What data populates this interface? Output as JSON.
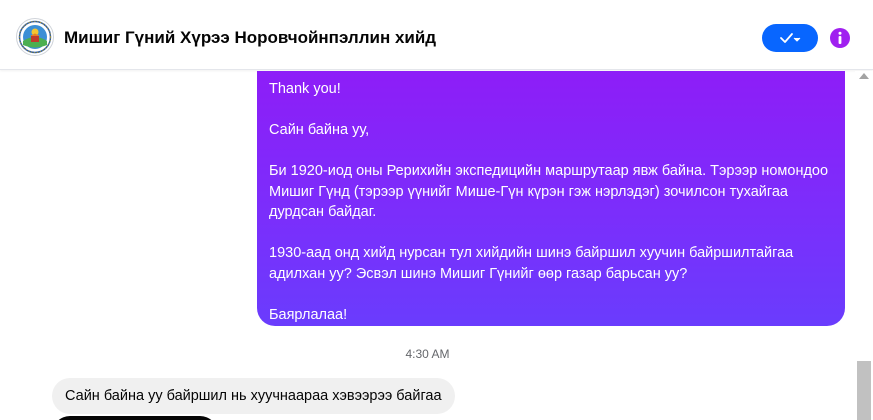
{
  "header": {
    "title": "Мишиг Гүний Хүрээ Норовчойнпэллин хийд",
    "avatar_icon": "monastery-logo-icon",
    "status_button_icon": "check-chevron-icon",
    "info_icon": "info-icon"
  },
  "messages": {
    "outgoing": {
      "lines": [
        "Thank you!",
        "",
        "Сайн байна уу,",
        "",
        "Би 1920-иод оны Рерихийн экспедицийн маршрутаар явж байна. Тэрээр номондоо Мишиг Гүнд (тэрээр үүнийг Мише-Гүн күрэн гэж нэрлэдэг) зочилсон тухайгаа дурдсан байдаг.",
        "",
        "1930-аад онд хийд нурсан тул хийдийн шинэ байршил хуучин байршилтайгаа адилхан уу? Эсвэл шинэ Мишиг Гүнийг өөр газар барьсан уу?",
        "",
        "Баярлалаа!"
      ]
    },
    "timestamp": "4:30 AM",
    "incoming": {
      "text": "Сайн байна уу байршил нь хуучнаараа хэвээрээ байгаа"
    }
  },
  "colors": {
    "accent": "#0866ff",
    "info": "#a020f0",
    "outgoing_bubble_top": "#8f1cf7",
    "outgoing_bubble_bottom": "#6a3cfd",
    "incoming_bubble": "#f0f0f0"
  }
}
